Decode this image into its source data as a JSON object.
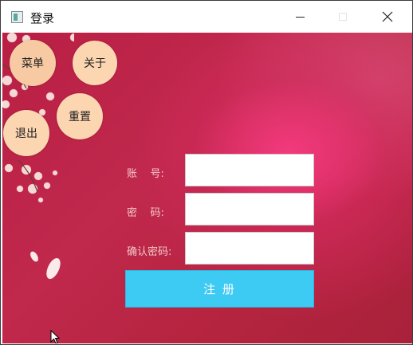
{
  "window": {
    "title": "登录",
    "icon": "app-icon"
  },
  "menu": {
    "menu_label": "菜单",
    "about_label": "关于",
    "reset_label": "重置",
    "exit_label": "退出"
  },
  "form": {
    "account_label": "账    号:",
    "password_label": "密    码:",
    "confirm_label": "确认密码:",
    "account_value": "",
    "password_value": "",
    "confirm_value": "",
    "register_label": "注 册"
  },
  "colors": {
    "background": "#c0284c",
    "button_bg": "#fcd5b1",
    "register_bg": "#3dcaf3"
  }
}
